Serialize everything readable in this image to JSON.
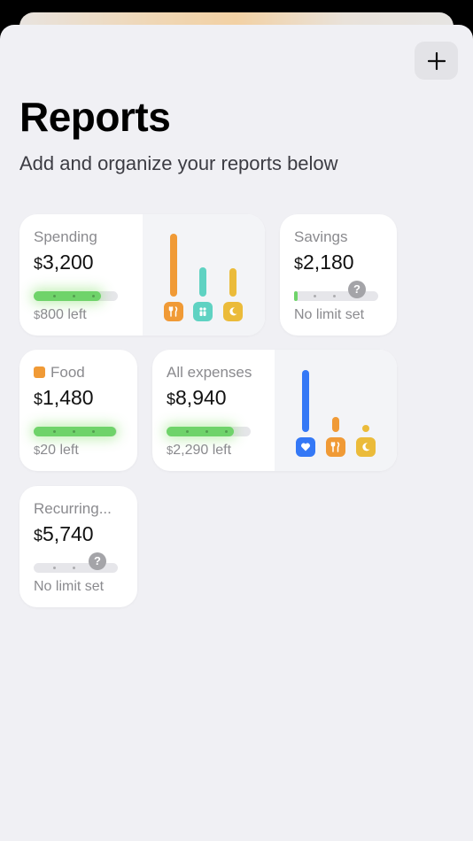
{
  "header": {
    "title": "Reports",
    "subtitle": "Add and organize your reports below",
    "add_icon": "plus-icon"
  },
  "colors": {
    "orange": "#f09a36",
    "teal": "#5fd2c2",
    "yellow": "#ebbb3a",
    "blue": "#3478f6",
    "green": "#6fd36a"
  },
  "cards": {
    "spending": {
      "label": "Spending",
      "currency": "$",
      "amount": "3,200",
      "foot_currency": "$",
      "foot": "800 left",
      "progress": 0.8,
      "bar_icons": [
        "fork-knife-icon",
        "people-icon",
        "moon-icon"
      ],
      "bar_levels": [
        1.0,
        0.45,
        0.43
      ]
    },
    "savings": {
      "label": "Savings",
      "currency": "$",
      "amount": "2,180",
      "foot": "No limit set",
      "progress": 0.03,
      "help_icon": "question-icon"
    },
    "food": {
      "label": "Food",
      "currency": "$",
      "amount": "1,480",
      "foot_currency": "$",
      "foot": "20 left",
      "progress": 0.99
    },
    "all_expenses": {
      "label": "All expenses",
      "currency": "$",
      "amount": "8,940",
      "foot_currency": "$",
      "foot": "2,290 left",
      "progress": 0.8,
      "bar_icons": [
        "heart-icon",
        "fork-knife-icon",
        "moon-icon"
      ],
      "bar_levels": [
        1.0,
        0.24,
        0.12
      ]
    },
    "recurring": {
      "label": "Recurring...",
      "currency": "$",
      "amount": "5,740",
      "foot": "No limit set",
      "progress": 0.0,
      "help_icon": "question-icon"
    }
  }
}
